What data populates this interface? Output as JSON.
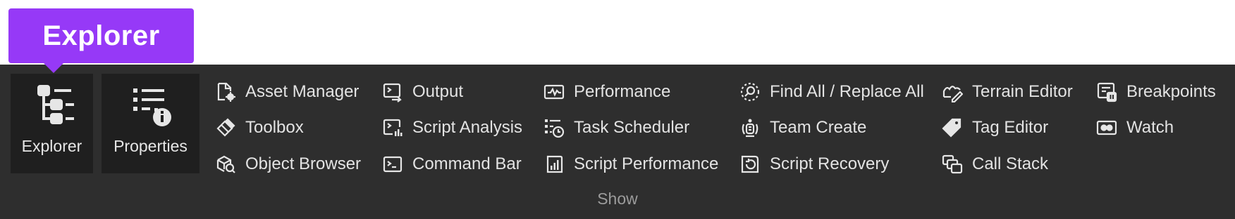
{
  "tooltip": {
    "text": "Explorer"
  },
  "ribbon": {
    "group_label": "Show",
    "large_buttons": [
      {
        "label": "Explorer",
        "icon": "explorer-tree-icon"
      },
      {
        "label": "Properties",
        "icon": "properties-info-icon"
      }
    ],
    "columns": [
      [
        {
          "label": "Asset Manager",
          "icon": "asset-manager-icon"
        },
        {
          "label": "Toolbox",
          "icon": "toolbox-icon"
        },
        {
          "label": "Object Browser",
          "icon": "object-browser-icon"
        }
      ],
      [
        {
          "label": "Output",
          "icon": "output-icon"
        },
        {
          "label": "Script Analysis",
          "icon": "script-analysis-icon"
        },
        {
          "label": "Command Bar",
          "icon": "command-bar-icon"
        }
      ],
      [
        {
          "label": "Performance",
          "icon": "performance-icon"
        },
        {
          "label": "Task Scheduler",
          "icon": "task-scheduler-icon"
        },
        {
          "label": "Script Performance",
          "icon": "script-performance-icon"
        }
      ],
      [
        {
          "label": "Find All / Replace All",
          "icon": "find-replace-icon"
        },
        {
          "label": "Team Create",
          "icon": "team-create-icon"
        },
        {
          "label": "Script Recovery",
          "icon": "script-recovery-icon"
        }
      ],
      [
        {
          "label": "Terrain Editor",
          "icon": "terrain-editor-icon"
        },
        {
          "label": "Tag Editor",
          "icon": "tag-icon"
        },
        {
          "label": "Call Stack",
          "icon": "call-stack-icon"
        }
      ],
      [
        {
          "label": "Breakpoints",
          "icon": "breakpoints-icon"
        },
        {
          "label": "Watch",
          "icon": "watch-icon"
        }
      ]
    ]
  }
}
